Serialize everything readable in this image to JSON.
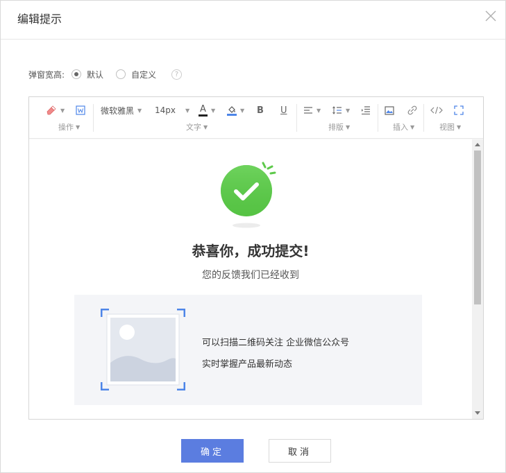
{
  "dialog": {
    "title": "编辑提示",
    "close_icon": "close-icon"
  },
  "size_option": {
    "label": "弹窗宽高:",
    "options": [
      {
        "label": "默认",
        "checked": true
      },
      {
        "label": "自定义",
        "checked": false
      }
    ],
    "help": "?"
  },
  "toolbar": {
    "font_family": "微软雅黑",
    "font_size": "14px",
    "text_color_glyph": "A",
    "bold_glyph": "B",
    "underline_glyph": "U",
    "groups": {
      "operate": "操作",
      "text": "文字",
      "layout": "排版",
      "insert": "插入",
      "view": "视图"
    }
  },
  "content": {
    "success_title": "恭喜你，成功提交!",
    "success_subtitle": "您的反馈我们已经收到",
    "qr_line1": "可以扫描二维码关注 企业微信公众号",
    "qr_line2": "实时掌握产品最新动态",
    "accent_green": "#5dc94a",
    "accent_blue": "#4d85e8"
  },
  "footer": {
    "ok_label": "确定",
    "cancel_label": "取消",
    "primary_color": "#5b7de0"
  }
}
